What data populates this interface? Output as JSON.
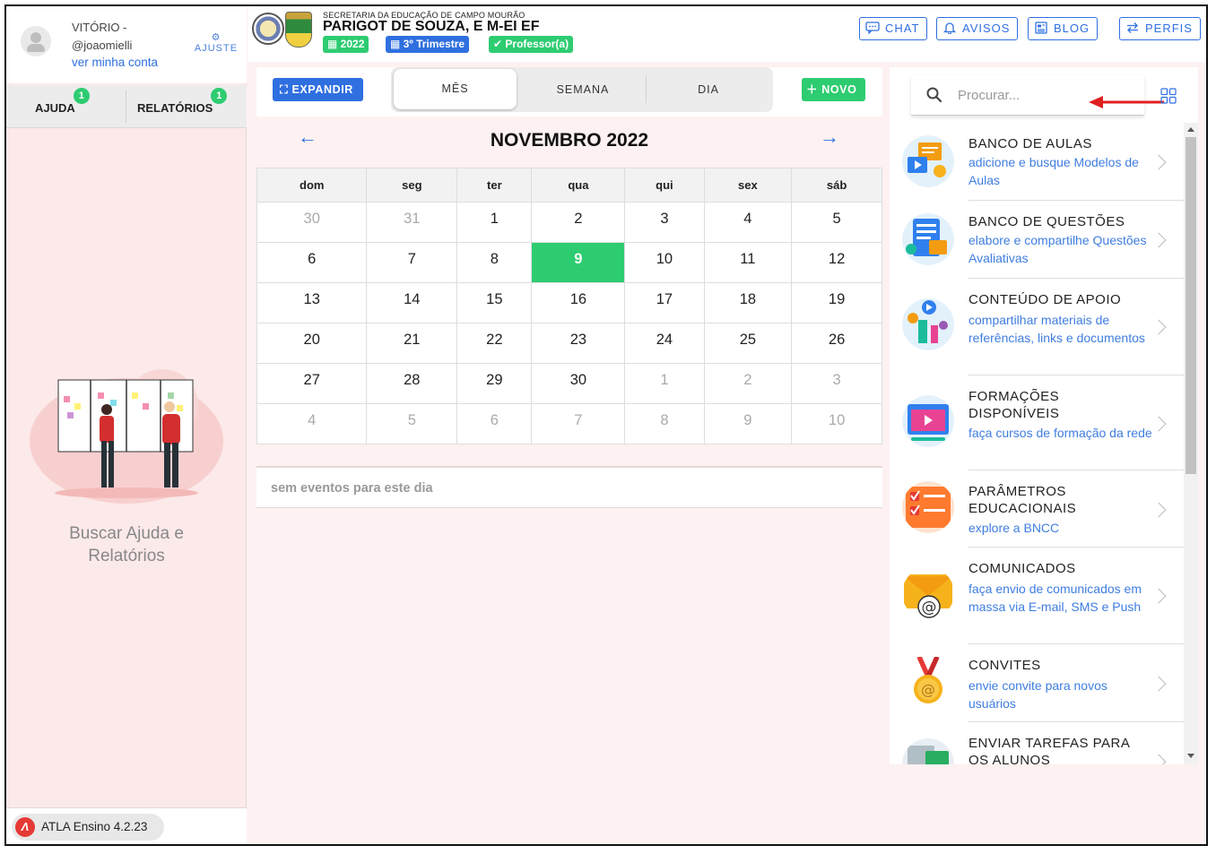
{
  "user": {
    "name": "VITÓRIO -",
    "handle": "@joaomielli",
    "my_account": "ver minha conta",
    "settings_label": "AJUSTE"
  },
  "left_tabs": [
    {
      "label": "AJUDA",
      "badge": "1"
    },
    {
      "label": "RELATÓRIOS",
      "badge": "1"
    }
  ],
  "help_text": "Buscar Ajuda e Relatórios",
  "version": "ATLA Ensino 4.2.23",
  "header": {
    "secretaria": "SECRETARIA DA EDUCAÇÃO DE CAMPO MOURÃO",
    "school": "PARIGOT DE SOUZA, E M-EI EF",
    "year": "2022",
    "term": "3º Trimestre",
    "role": "Professor(a)"
  },
  "top_buttons": {
    "chat": "CHAT",
    "avisos": "AVISOS",
    "blog": "BLOG",
    "perfis": "PERFIS"
  },
  "calendar": {
    "expand_label": "EXPANDIR",
    "views": [
      "MÊS",
      "SEMANA",
      "DIA"
    ],
    "active_view": "MÊS",
    "new_label": "NOVO",
    "month_title": "NOVEMBRO 2022",
    "weekdays": [
      "dom",
      "seg",
      "ter",
      "qua",
      "qui",
      "sex",
      "sáb"
    ],
    "weeks": [
      [
        "30",
        "31",
        "1",
        "2",
        "3",
        "4",
        "5"
      ],
      [
        "6",
        "7",
        "8",
        "9",
        "10",
        "11",
        "12"
      ],
      [
        "13",
        "14",
        "15",
        "16",
        "17",
        "18",
        "19"
      ],
      [
        "20",
        "21",
        "22",
        "23",
        "24",
        "25",
        "26"
      ],
      [
        "27",
        "28",
        "29",
        "30",
        "1",
        "2",
        "3"
      ],
      [
        "4",
        "5",
        "6",
        "7",
        "8",
        "9",
        "10"
      ]
    ],
    "selected_day": "9",
    "no_events": "sem eventos para este dia"
  },
  "search": {
    "placeholder": "Procurar..."
  },
  "modules": [
    {
      "title": "BANCO DE AULAS",
      "desc": "adicione e busque Modelos de Aulas",
      "icon": "lessons-bank-icon",
      "color": "#f39c12"
    },
    {
      "title": "BANCO DE QUESTÕES",
      "desc": "elabore e compartilhe Questões Avaliativas",
      "icon": "questions-bank-icon",
      "color": "#2f80ed"
    },
    {
      "title": "CONTEÚDO DE APOIO",
      "desc": "compartilhar materiais de referências, links e documentos",
      "icon": "support-content-icon",
      "color": "#1abc9c"
    },
    {
      "title": "FORMAÇÕES DISPONÍVEIS",
      "desc": "faça cursos de formação da rede",
      "icon": "training-icon",
      "color": "#e84393"
    },
    {
      "title": "PARÂMETROS EDUCACIONAIS",
      "desc": "explore a BNCC",
      "icon": "bncc-icon",
      "color": "#ff7a2f"
    },
    {
      "title": "COMUNICADOS",
      "desc": "faça envio de comunicados em massa via E-mail, SMS e Push",
      "icon": "email-icon",
      "color": "#f6b21b"
    },
    {
      "title": "CONVITES",
      "desc": "envie convite para novos usuários",
      "icon": "medal-icon",
      "color": "#e8a23a"
    },
    {
      "title": "ENVIAR TAREFAS PARA OS ALUNOS",
      "desc": "",
      "icon": "tasks-icon",
      "color": "#27ae60"
    }
  ]
}
